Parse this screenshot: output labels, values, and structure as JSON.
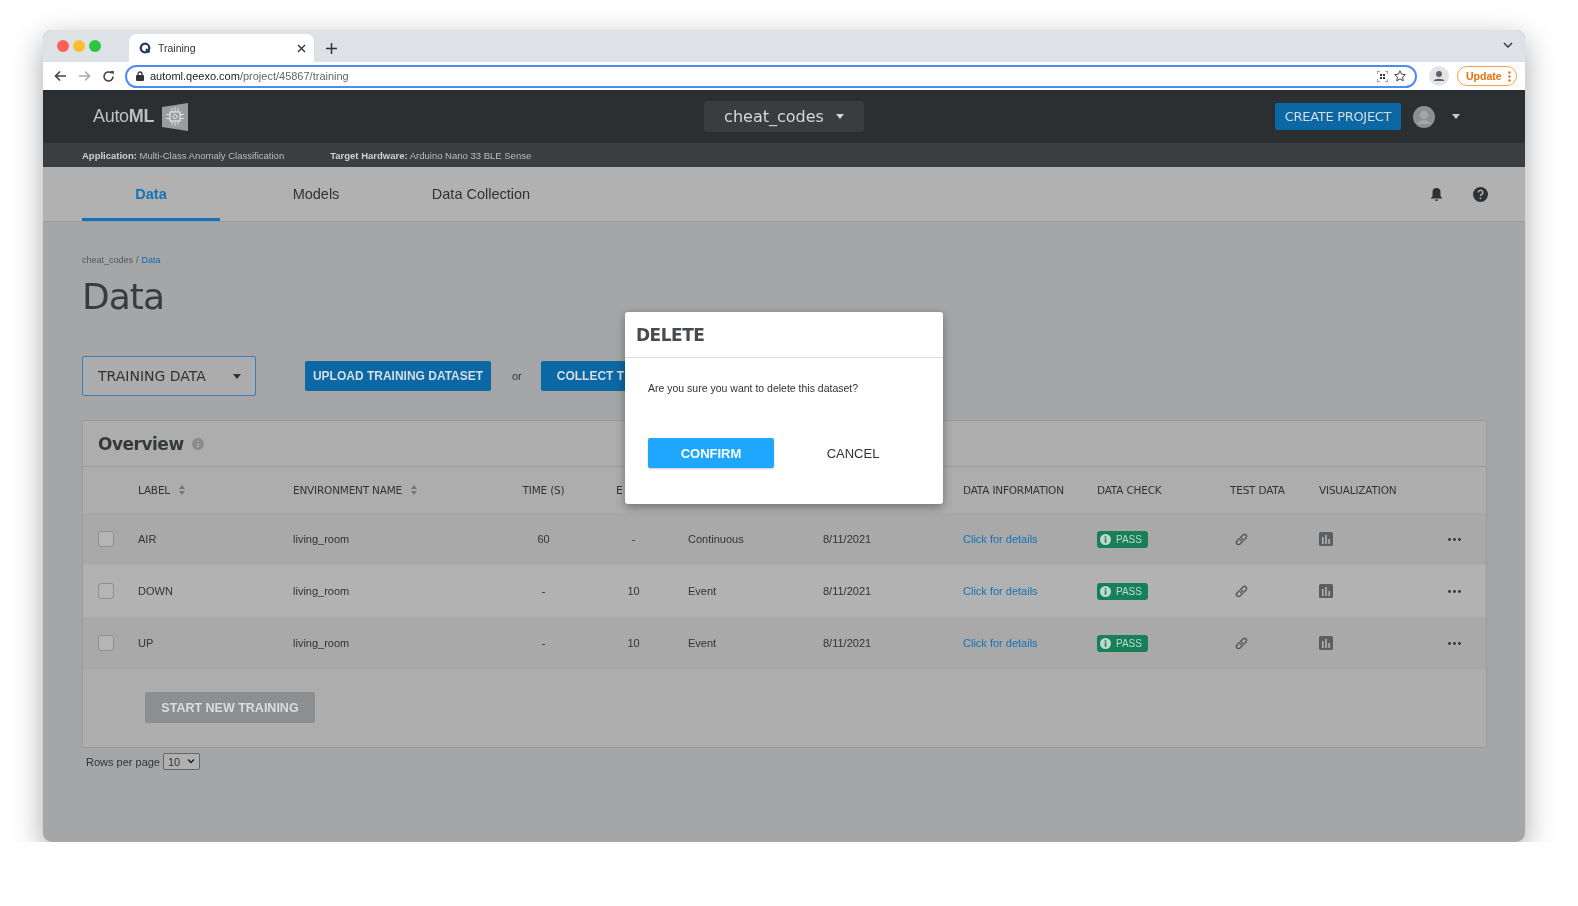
{
  "browser": {
    "tab": {
      "title": "Training",
      "selected": true
    },
    "url_host": "automl.qeexo.com",
    "url_path": "/project/45867/training",
    "update_button": "Update"
  },
  "header": {
    "logo": "Auto**ML**",
    "project": "cheat_codes",
    "create_button": "CREATE PROJECT"
  },
  "project_info": [
    "**Application:** Multi-Class Anomaly Classification",
    "**Target Hardware:** Arduino Nano 33 BLE Sense"
  ],
  "tabs": [
    {
      "label": "Data",
      "selected": true
    },
    {
      "label": "Models",
      "selected": false
    },
    {
      "label": "Data Collection",
      "selected": false
    }
  ],
  "breadcrumb": {
    "parent": "cheat_codes",
    "separator": "/",
    "current": "Data"
  },
  "page_title": "Data",
  "dataset_select": "TRAINING DATA",
  "upload_button": "UPLOAD TRAINING DATASET",
  "or_text": "or",
  "collect_button": "COLLECT T",
  "overview": {
    "title": "Overview",
    "columns": [
      {
        "label": "LABEL",
        "sortable": true
      },
      {
        "label": "ENVIRONMENT NAME",
        "sortable": true
      },
      {
        "label": "TIME (S)",
        "sortable": false
      },
      {
        "label": "E",
        "sortable": false
      },
      {
        "label": "DATA INFORMATION",
        "sortable": false
      },
      {
        "label": "DATA CHECK",
        "sortable": false
      },
      {
        "label": "TEST DATA",
        "sortable": false
      },
      {
        "label": "VISUALIZATION",
        "sortable": false
      }
    ],
    "rows": [
      {
        "checked": false,
        "label": "AIR",
        "environment": "living_room",
        "time": "60",
        "events": "-",
        "type": "Continuous",
        "date": "8/11/2021",
        "details": "Click for details",
        "check": "PASS"
      },
      {
        "checked": false,
        "label": "DOWN",
        "environment": "living_room",
        "time": "-",
        "events": "10",
        "type": "Event",
        "date": "8/11/2021",
        "details": "Click for details",
        "check": "PASS"
      },
      {
        "checked": false,
        "label": "UP",
        "environment": "living_room",
        "time": "-",
        "events": "10",
        "type": "Event",
        "date": "8/11/2021",
        "details": "Click for details",
        "check": "PASS"
      }
    ],
    "start_button": "START NEW TRAINING",
    "start_disabled": true
  },
  "pagination": {
    "label": "Rows per page",
    "value": "10"
  },
  "dialog": {
    "title": "DELETE",
    "message": "Are you sure you want to delete this dataset?",
    "confirm": "CONFIRM",
    "cancel": "CANCEL"
  }
}
